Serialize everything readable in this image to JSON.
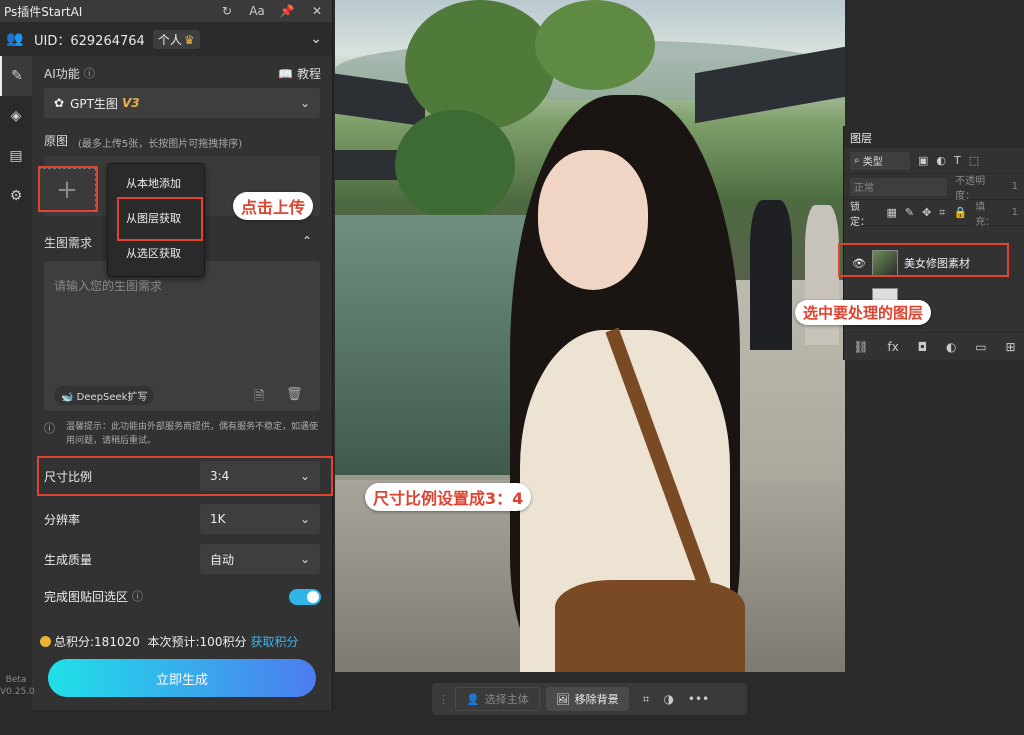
{
  "plugin": {
    "title": "Ps插件StartAI",
    "titlebar_icons": [
      "refresh-icon",
      "font-size-icon",
      "pin-icon",
      "close-icon"
    ],
    "uid_label": "UID：629264764",
    "plan": "个人",
    "ai_func_label": "AI功能",
    "tutorial_label": "教程",
    "model_name": "GPT生图",
    "model_version": "V3",
    "original_label": "原图",
    "original_hint": "(最多上传5张，长按图片可拖拽排序)",
    "upload_plus": "+",
    "upload_menu": [
      "从本地添加",
      "从图层获取",
      "从选区获取"
    ],
    "gen_req_label": "生图需求",
    "prompt_placeholder": "请输入您的生图需求",
    "deepseek_label": "DeepSeek扩写",
    "notice": "温馨提示：此功能由外部服务商提供，偶有服务不稳定，如遇使用问题，请稍后重试。",
    "size_label": "尺寸比例",
    "size_value": "3:4",
    "resolution_label": "分辨率",
    "resolution_value": "1K",
    "quality_label": "生成质量",
    "quality_value": "自动",
    "paste_label": "完成图贴回选区",
    "paste_enabled": true,
    "total_points": "总积分:181020",
    "estimate": "本次预计:100积分",
    "get_points": "获取积分",
    "generate_label": "立即生成",
    "beta_label": "Beta",
    "version_label": "V0.25.0"
  },
  "callouts": {
    "upload": "点击上传",
    "ratio": "尺寸比例设置成3：4",
    "layer": "选中要处理的图层"
  },
  "layers_panel": {
    "tab": "图层",
    "kind": "类型",
    "blend_mode": "正常",
    "opacity_label": "不透明度：",
    "opacity_value": "1",
    "lock_label": "锁定：",
    "fill_label": "填充：",
    "fill_value": "1",
    "layer_name": "美女修图素材"
  },
  "bottom_bar": {
    "select_subject": "选择主体",
    "remove_bg": "移除背景"
  },
  "colors": {
    "accent_red": "#e0432f",
    "toggle_blue": "#2fb5e8",
    "gold": "#e9b24a",
    "link_blue": "#39b5ef"
  }
}
